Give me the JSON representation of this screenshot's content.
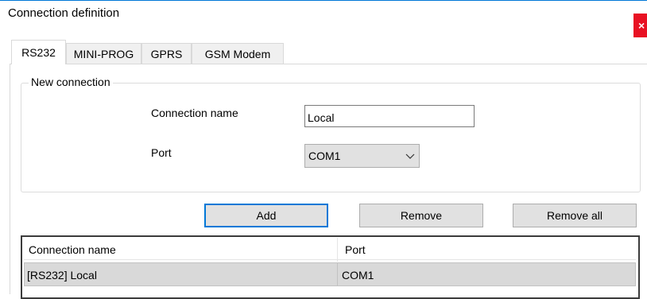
{
  "window": {
    "title": "Connection definition",
    "close_glyph": "×",
    "accent_color": "#0078d7",
    "close_color": "#e81123"
  },
  "tabs": [
    {
      "label": "RS232",
      "active": true
    },
    {
      "label": "MINI-PROG",
      "active": false
    },
    {
      "label": "GPRS",
      "active": false
    },
    {
      "label": "GSM Modem",
      "active": false
    }
  ],
  "new_connection": {
    "legend": "New connection",
    "name_label": "Connection name",
    "name_value": "Local",
    "port_label": "Port",
    "port_value": "COM1",
    "port_arrow_icon": "chevron-down-icon"
  },
  "buttons": {
    "add": "Add",
    "remove": "Remove",
    "remove_all": "Remove all"
  },
  "list": {
    "columns": [
      "Connection name",
      "Port"
    ],
    "rows": [
      {
        "name": "[RS232] Local",
        "port": "COM1",
        "selected": true
      }
    ]
  }
}
